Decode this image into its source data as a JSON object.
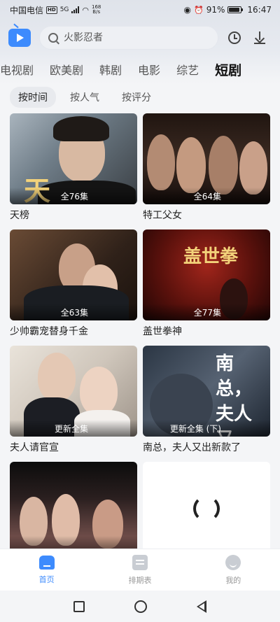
{
  "status_bar": {
    "carrier": "中国电信",
    "hd": "HD",
    "network": "5G",
    "speed": "168\nB/s",
    "battery": "91%",
    "time": "16:47"
  },
  "header": {
    "search_placeholder": "火影忍者",
    "icons": [
      "app-logo-icon",
      "search-icon",
      "history-icon",
      "download-icon"
    ]
  },
  "category_tabs": [
    {
      "label": "电视剧",
      "active": false
    },
    {
      "label": "欧美剧",
      "active": false
    },
    {
      "label": "韩剧",
      "active": false
    },
    {
      "label": "电影",
      "active": false
    },
    {
      "label": "综艺",
      "active": false
    },
    {
      "label": "短剧",
      "active": true
    }
  ],
  "sort_options": [
    {
      "label": "按时间",
      "active": true
    },
    {
      "label": "按人气",
      "active": false
    },
    {
      "label": "按评分",
      "active": false
    }
  ],
  "cards": [
    {
      "title": "天榜",
      "badge": "全76集",
      "poster_text": "天"
    },
    {
      "title": "特工父女",
      "badge": "全64集",
      "poster_text": ""
    },
    {
      "title": "少帅霸宠替身千金",
      "badge": "全63集",
      "poster_text": ""
    },
    {
      "title": "盖世拳神",
      "badge": "全77集",
      "poster_text": "盖世拳"
    },
    {
      "title": "夫人请官宣",
      "badge": "更新全集",
      "poster_text": ""
    },
    {
      "title": "南总，夫人又出新款了",
      "badge": "更新全集 (下)",
      "poster_text": "南总，夫人又"
    },
    {
      "title": "",
      "badge": "",
      "poster_text": ""
    },
    {
      "title": "",
      "badge": "",
      "poster_text": ""
    }
  ],
  "bottom_nav": [
    {
      "label": "首页",
      "icon": "home-icon",
      "active": true
    },
    {
      "label": "排期表",
      "icon": "schedule-icon",
      "active": false
    },
    {
      "label": "我的",
      "icon": "profile-icon",
      "active": false
    }
  ],
  "colors": {
    "accent": "#3d8bfd",
    "background": "#f4f5f7"
  }
}
